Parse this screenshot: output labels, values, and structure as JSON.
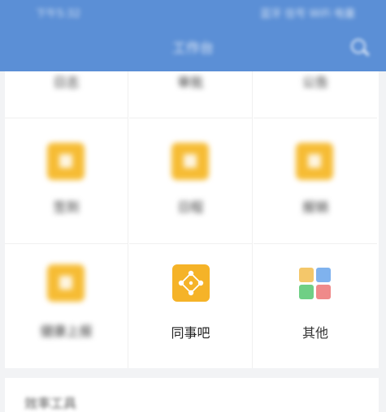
{
  "status_bar": {
    "time": "下午5:32",
    "indicators": "蓝牙 信号 WiFi 电量"
  },
  "navbar": {
    "title": "工作台"
  },
  "grid": {
    "top_row_labels": [
      "日志",
      "审批",
      "公告"
    ],
    "middle_row_labels": [
      "签到",
      "日程",
      "报销"
    ],
    "bottom_row": {
      "health_report": "健康上报",
      "colleague_bar": "同事吧",
      "other": "其他"
    }
  },
  "section": {
    "title": "效率工具"
  },
  "colors": {
    "header": "#5b8fd6",
    "icon_yellow": "#f6bc34",
    "icon_orange": "#f5b328",
    "other_tile_1": "#f4c76a",
    "other_tile_2": "#7fb2ee",
    "other_tile_3": "#6fcf85",
    "other_tile_4": "#ef8a8a"
  },
  "icons": {
    "colleague_bar": "diamond-network-icon",
    "other": "four-tiles-icon"
  }
}
